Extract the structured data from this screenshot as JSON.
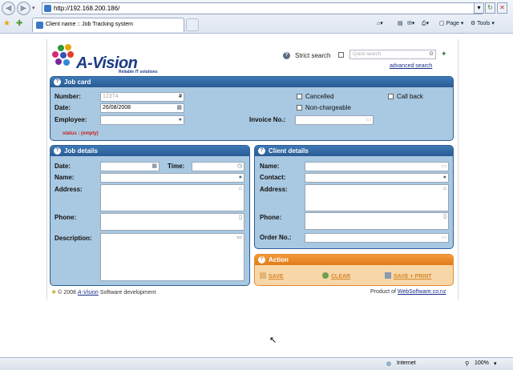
{
  "browser": {
    "url": "http://192.168.200.186/",
    "tab_title": "Client name :: Job Tracking system",
    "page_menu": "Page",
    "tools_menu": "Tools",
    "status_zone": "Internet",
    "zoom": "100%"
  },
  "header": {
    "logo_text": "A-Vision",
    "logo_tagline": "Reliable IT solutions",
    "strict_search_label": "Strict search",
    "search_placeholder": "Quick search",
    "advanced_search": "advanced search"
  },
  "job_card": {
    "title": "Job card",
    "number_label": "Number:",
    "number_value": "12374",
    "number_icon": "#",
    "date_label": "Date:",
    "date_value": "26/08/2008",
    "employee_label": "Employee:",
    "cancelled_label": "Cancelled",
    "call_back_label": "Call back",
    "non_chargeable_label": "Non-chargeable",
    "invoice_label": "Invoice No.:",
    "status_text": "status : (empty)"
  },
  "job_details": {
    "title": "Job details",
    "date_label": "Date:",
    "time_label": "Time:",
    "name_label": "Name:",
    "address_label": "Address:",
    "phone_label": "Phone:",
    "description_label": "Description:"
  },
  "client_details": {
    "title": "Client details",
    "name_label": "Name:",
    "contact_label": "Contact:",
    "address_label": "Address:",
    "phone_label": "Phone:",
    "order_label": "Order No.:"
  },
  "action": {
    "title": "Action",
    "save": "SAVE",
    "clear": "CLEAR",
    "save_print": "SAVE + PRINT"
  },
  "footer": {
    "copyright_prefix": "© 2008",
    "company": "A-Vision",
    "copyright_suffix": "Software development",
    "product_prefix": "Product of",
    "product_link": "WebSoftware.co.nz"
  }
}
